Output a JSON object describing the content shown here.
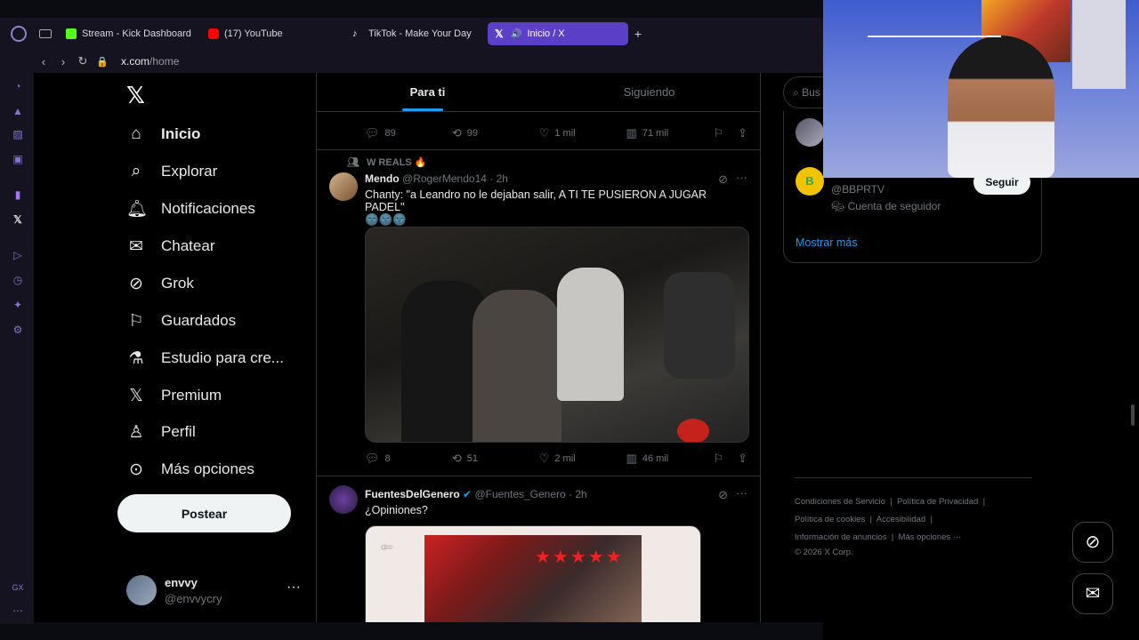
{
  "browser": {
    "tabs": [
      {
        "label": "Stream - Kick Dashboard",
        "favicon_color": "#53fc18"
      },
      {
        "label": "(17) YouTube",
        "favicon_color": "#ff0000"
      },
      {
        "label": "TikTok - Make Your Day",
        "favicon_color": "#ffffff"
      },
      {
        "label": "Inicio / X",
        "favicon_color": "#ffffff"
      }
    ],
    "url_domain": "x.com",
    "url_path": "/home"
  },
  "sidebar": {
    "items": [
      {
        "label": "Inicio",
        "icon": "home-icon"
      },
      {
        "label": "Explorar",
        "icon": "search-icon"
      },
      {
        "label": "Notificaciones",
        "icon": "bell-icon"
      },
      {
        "label": "Chatear",
        "icon": "mail-icon"
      },
      {
        "label": "Grok",
        "icon": "grok-icon"
      },
      {
        "label": "Guardados",
        "icon": "bookmark-icon"
      },
      {
        "label": "Estudio para cre...",
        "icon": "flask-icon"
      },
      {
        "label": "Premium",
        "icon": "x-icon"
      },
      {
        "label": "Perfil",
        "icon": "person-icon"
      },
      {
        "label": "Más opciones",
        "icon": "more-circle-icon"
      }
    ],
    "post_label": "Postear",
    "account": {
      "name": "envvy",
      "handle": "@envvycry"
    }
  },
  "feed": {
    "tabs": [
      "Para ti",
      "Siguiendo"
    ],
    "prev_tweet_stats": {
      "replies": "89",
      "reposts": "99",
      "likes": "1 mil",
      "views": "71 mil"
    },
    "tweet1": {
      "repost_label": "W REALS 🔥",
      "name": "Mendo",
      "handle": "@RogerMendo14",
      "time": "· 2h",
      "text": "Chanty: \"a Leandro no le dejaban salir, A TI TE PUSIERON A JUGAR PADEL\"",
      "emojis": "🌚🌚🌚",
      "stats": {
        "replies": "8",
        "reposts": "51",
        "likes": "2 mil",
        "views": "46 mil"
      }
    },
    "tweet2": {
      "name": "FuentesDelGenero",
      "handle": "@Fuentes_Genero",
      "time": "· 2h",
      "text": "¿Opiniones?"
    }
  },
  "right": {
    "search_placeholder": "Bus",
    "account_handle": "@BBPRTV",
    "account_note": "Cuenta de seguidor",
    "follow_label": "Seguir",
    "show_more": "Mostrar más",
    "footer": {
      "line1a": "Condiciones de Servicio",
      "line1b": "Política de Privacidad",
      "line2a": "Política de cookies",
      "line2b": "Accesibilidad",
      "line3a": "Información de anuncios",
      "line3b": "Más opciones ···",
      "copyright": "© 2026 X Corp."
    }
  },
  "colors": {
    "accent": "#1d9bf0",
    "opera_tab_active": "#5b3fc6"
  }
}
